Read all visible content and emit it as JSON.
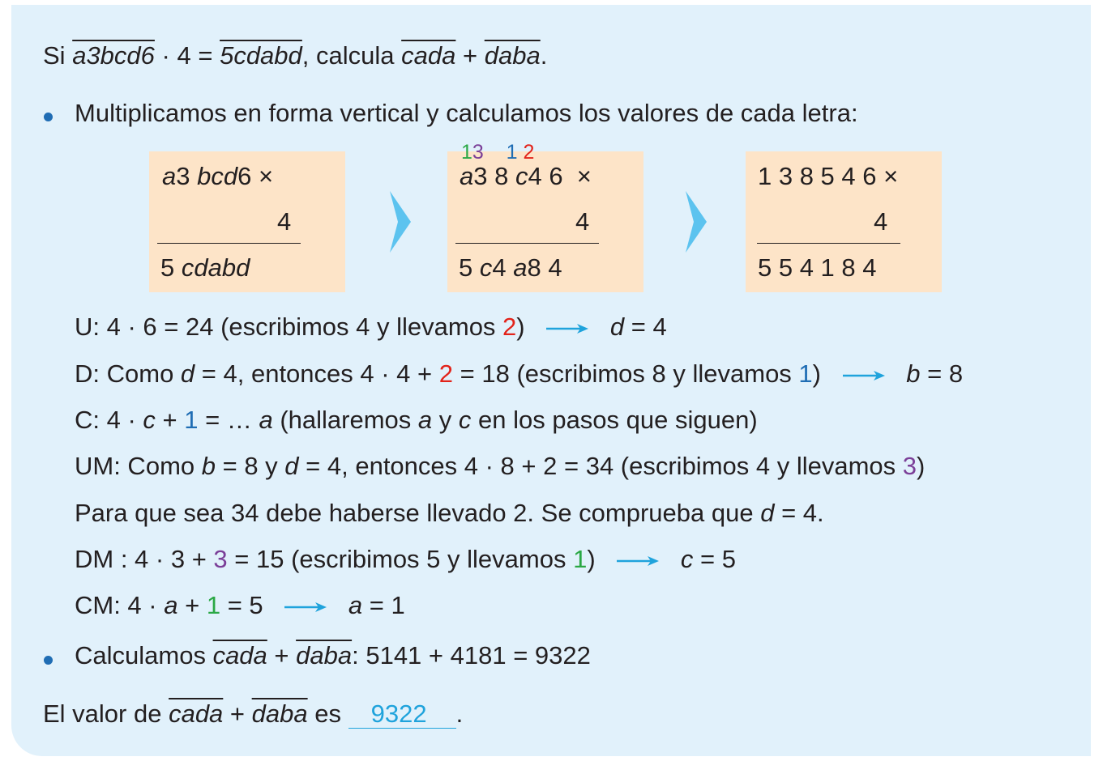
{
  "problem": {
    "si": "Si",
    "lhs_number": "a3bcd6",
    "times_4_eq": "· 4 =",
    "rhs_number": "5cdabd",
    "calcula": ", calcula",
    "term1": "cada",
    "plus": "+",
    "term2": "daba",
    "period": "."
  },
  "bullet1": "Multiplicamos en forma vertical y calculamos los valores de cada letra:",
  "box1": {
    "top": "a3 bcd6 ×",
    "mid": "4",
    "bottom": "5 cdabd"
  },
  "box2": {
    "carry_green": "1",
    "carry_purple": "3",
    "carry_blue": "1",
    "carry_red": "2",
    "top": "a3 8 c4 6 ×",
    "mid": "4",
    "bottom": "5 c4 a8 4"
  },
  "box3": {
    "top": "1 3 8 5 4 6 ×",
    "mid": "4",
    "bottom": "5 5 4 1 8 4"
  },
  "steps": {
    "u_text": "U: 4 · 6 = 24 (escribimos 4 y llevamos ",
    "u_carry": "2",
    "u_close": ")",
    "u_result_var": "d",
    "u_result": " = 4",
    "d_a": "D: Como ",
    "d_var": "d",
    "d_b": " = 4, entonces 4 · 4 + ",
    "d_carry_in": "2",
    "d_c": " = 18 (escribimos 8 y llevamos ",
    "d_carry_out": "1",
    "d_close": ")",
    "d_result_var": "b",
    "d_result": " = 8",
    "c_a": "C: 4 · ",
    "c_var": "c",
    "c_b": " + ",
    "c_carry": "1",
    "c_c": " = … ",
    "c_var2": "a",
    "c_d": " (hallaremos ",
    "c_var3": "a",
    "c_e": " y ",
    "c_var4": "c",
    "c_f": " en los pasos que siguen)",
    "um_a": "UM: Como ",
    "um_var1": "b",
    "um_b": " = 8 y ",
    "um_var2": "d",
    "um_c": " = 4, entonces 4 · 8 + 2 =  34 (escribimos 4 y llevamos ",
    "um_carry": "3",
    "um_close": ")",
    "check_a": "Para que sea 34 debe haberse llevado 2. Se comprueba que ",
    "check_var": "d",
    "check_b": " = 4.",
    "dm_a": "DM : 4 · 3 + ",
    "dm_carry_in": "3",
    "dm_b": " = 15 (escribimos 5 y llevamos ",
    "dm_carry_out": "1",
    "dm_close": ")",
    "dm_result_var": "c",
    "dm_result": " = 5",
    "cm_a": "CM: 4 · ",
    "cm_var": "a",
    "cm_b": " + ",
    "cm_carry": "1",
    "cm_c": " = 5",
    "cm_result_var": "a",
    "cm_result": " = 1"
  },
  "bullet2": {
    "label": "Calculamos ",
    "term1": "cada",
    "plus": " + ",
    "term2": "daba",
    "rest": ":  5141 + 4181 = 9322"
  },
  "conclusion": {
    "label": "El valor de ",
    "term1": "cada",
    "plus": " + ",
    "term2": "daba",
    "es": " es ",
    "answer": "9322",
    "period": "."
  },
  "colors": {
    "panel": "#e1f1fb",
    "box": "#fde4c8",
    "arrow": "#5cc3ef",
    "red": "#e2231a",
    "blue": "#1f6db4",
    "green": "#2aa845",
    "purple": "#7b3f98",
    "answer": "#1fa3dc"
  }
}
